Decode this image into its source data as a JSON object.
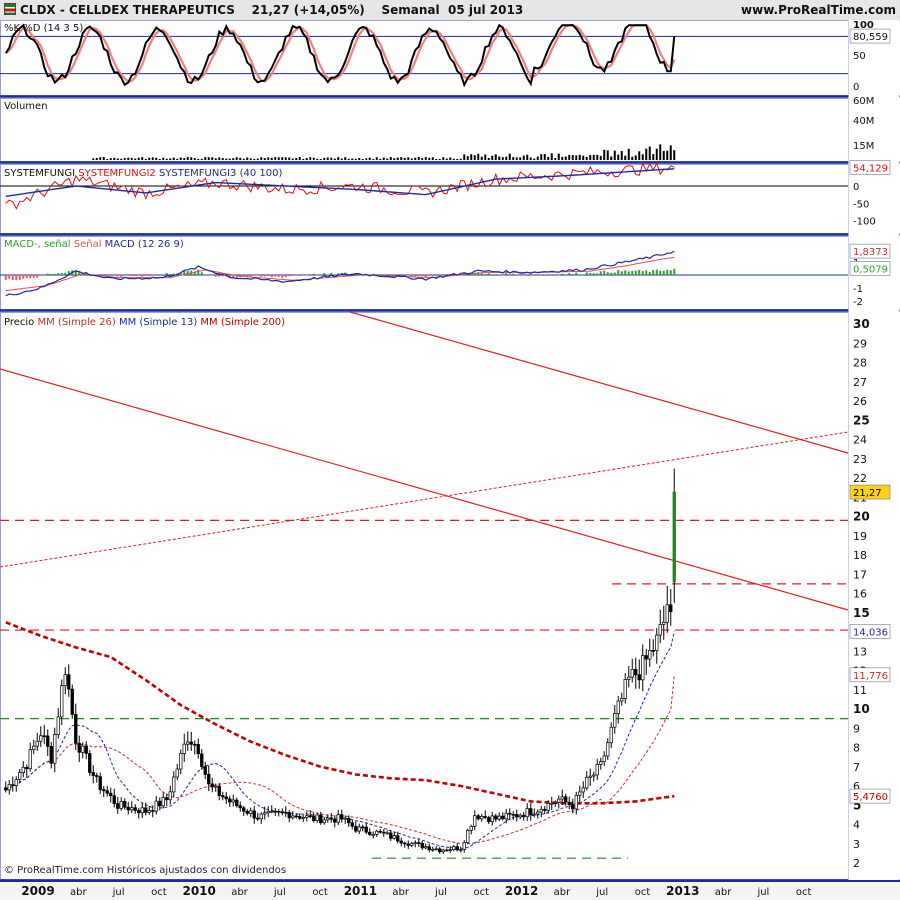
{
  "header": {
    "symbol": "CLDX - CELLDEX THERAPEUTICS",
    "price_change": "21,27 (+14,05%)",
    "period": "Semanal",
    "date": "05 jul 2013",
    "site": "www.ProRealTime.com"
  },
  "footer": {
    "credit": "© ProRealTime.com  Históricos ajustados con dividendos"
  },
  "x_axis": {
    "labels": [
      "2009",
      "abr",
      "jul",
      "oct",
      "2010",
      "abr",
      "jul",
      "oct",
      "2011",
      "abr",
      "jul",
      "oct",
      "2012",
      "abr",
      "jul",
      "oct",
      "2013",
      "abr",
      "jul",
      "oct"
    ],
    "bold": [
      "2009",
      "2010",
      "2011",
      "2012",
      "2013"
    ]
  },
  "colors": {
    "panel_border": "#1b2aa8",
    "up_candle": "#ffffff",
    "down_candle": "#000000",
    "trend_red": "#e02020",
    "mm26": "#c03030",
    "mm13": "#1c2a9c",
    "mm200": "#c00000",
    "support_green": "#1f8a1f",
    "macd_fill": "#2ca02c"
  },
  "chart_data": [
    {
      "type": "line",
      "title": "%K %D (14 3 5)",
      "series": [
        {
          "name": "%K"
        },
        {
          "name": "%D"
        }
      ],
      "y_ticks": [
        "100",
        "50",
        "0"
      ],
      "reference_lines": [
        20,
        80
      ],
      "last_value_label": "80,559",
      "last_value": 80.559,
      "ylim": [
        0,
        100
      ]
    },
    {
      "type": "bar",
      "title": "Volumen",
      "y_ticks": [
        "60M",
        "40M",
        "15M"
      ],
      "ylim": [
        0,
        70
      ]
    },
    {
      "type": "line",
      "title_parts": [
        "SYSTEMFUNGI",
        "SYSTEMFUNGI2",
        "SYSTEMFUNGI3",
        "(40 100)"
      ],
      "series": [
        {
          "name": "SYSTEMFUNGI2"
        },
        {
          "name": "SYSTEMFUNGI3"
        }
      ],
      "y_ticks": [
        "0",
        "-50",
        "-100"
      ],
      "last_value_label": "54,129",
      "last_value": 54.129,
      "ylim": [
        -130,
        100
      ]
    },
    {
      "type": "area",
      "title_parts": [
        "MACD-, señal",
        "Señal",
        "MACD",
        "(12 26 9)"
      ],
      "y_ticks": [
        "1",
        "-1",
        "-2"
      ],
      "last_value_labels": [
        "1,8373",
        "0,5079"
      ],
      "last_values": [
        1.8373,
        0.5079
      ],
      "ylim": [
        -2.4,
        2.5
      ]
    },
    {
      "type": "candlestick",
      "title_parts": [
        "Precio",
        "MM",
        "(Simple 26)",
        "MM",
        "(Simple 13)",
        "MM",
        "(Simple 200)"
      ],
      "y_ticks": [
        "30",
        "29",
        "28",
        "27",
        "26",
        "25",
        "24",
        "23",
        "22",
        "21",
        "20",
        "19",
        "18",
        "17",
        "16",
        "15",
        "13",
        "12",
        "11",
        "10",
        "9",
        "8",
        "7",
        "6",
        "5",
        "4",
        "3",
        "2"
      ],
      "y_ticks_bold": [
        "30",
        "25",
        "20",
        "15",
        "10",
        "5"
      ],
      "last_price_label": "21,27",
      "last_price": 21.27,
      "mm13_label": "14,036",
      "mm13_last": 14.036,
      "mm26_label": "11,776",
      "mm26_last": 11.776,
      "mm200_label": "5,4760",
      "mm200_last": 5.476,
      "horizontal_levels": [
        {
          "value": 19.8,
          "color": "red",
          "style": "dashed"
        },
        {
          "value": 16.5,
          "color": "red",
          "style": "dashed"
        },
        {
          "value": 14.1,
          "color": "red",
          "style": "dashed"
        },
        {
          "value": 9.5,
          "color": "green",
          "style": "dashed"
        },
        {
          "value": 2.25,
          "color": "green",
          "style": "dashed"
        }
      ],
      "ylim": [
        1.5,
        30.8
      ]
    }
  ]
}
